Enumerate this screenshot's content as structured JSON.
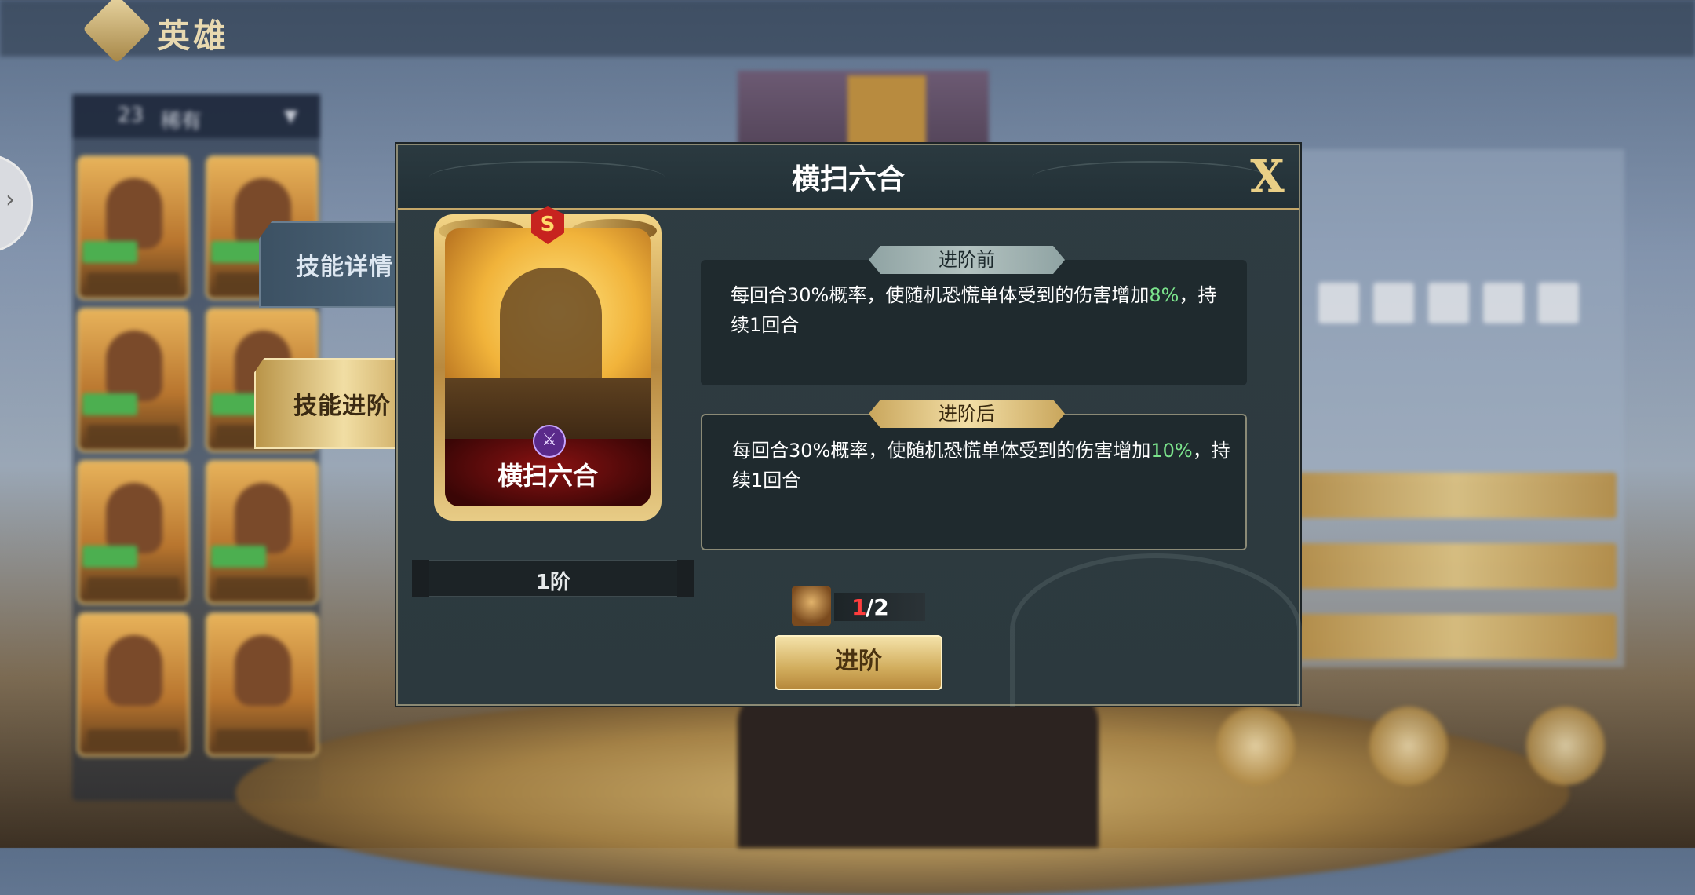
{
  "header": {
    "title": "英雄"
  },
  "roster": {
    "count": "23",
    "filter_label": "稀有"
  },
  "side_tabs": [
    {
      "label": "技能详情",
      "active": false
    },
    {
      "label": "技能进阶",
      "active": true
    }
  ],
  "modal": {
    "title": "横扫六合",
    "close_label": "X",
    "skill_card": {
      "name": "横扫六合",
      "grade_badge": "S",
      "level": "1阶"
    },
    "before": {
      "label": "进阶前",
      "desc_pre": "每回合30%概率，使随机恐慌单体受到的伤害增加",
      "desc_value": "8%",
      "desc_post": "，持续1回合"
    },
    "after": {
      "label": "进阶后",
      "desc_pre": "每回合30%概率，使随机恐慌单体受到的伤害增加",
      "desc_value": "10%",
      "desc_post": "，持续1回合"
    },
    "cost": {
      "have": "1",
      "need": "/2"
    },
    "advance_button": "进阶"
  },
  "colors": {
    "accent_gold": "#c4a769",
    "value_green": "#7be38c",
    "cost_red": "#ff3d3d"
  }
}
